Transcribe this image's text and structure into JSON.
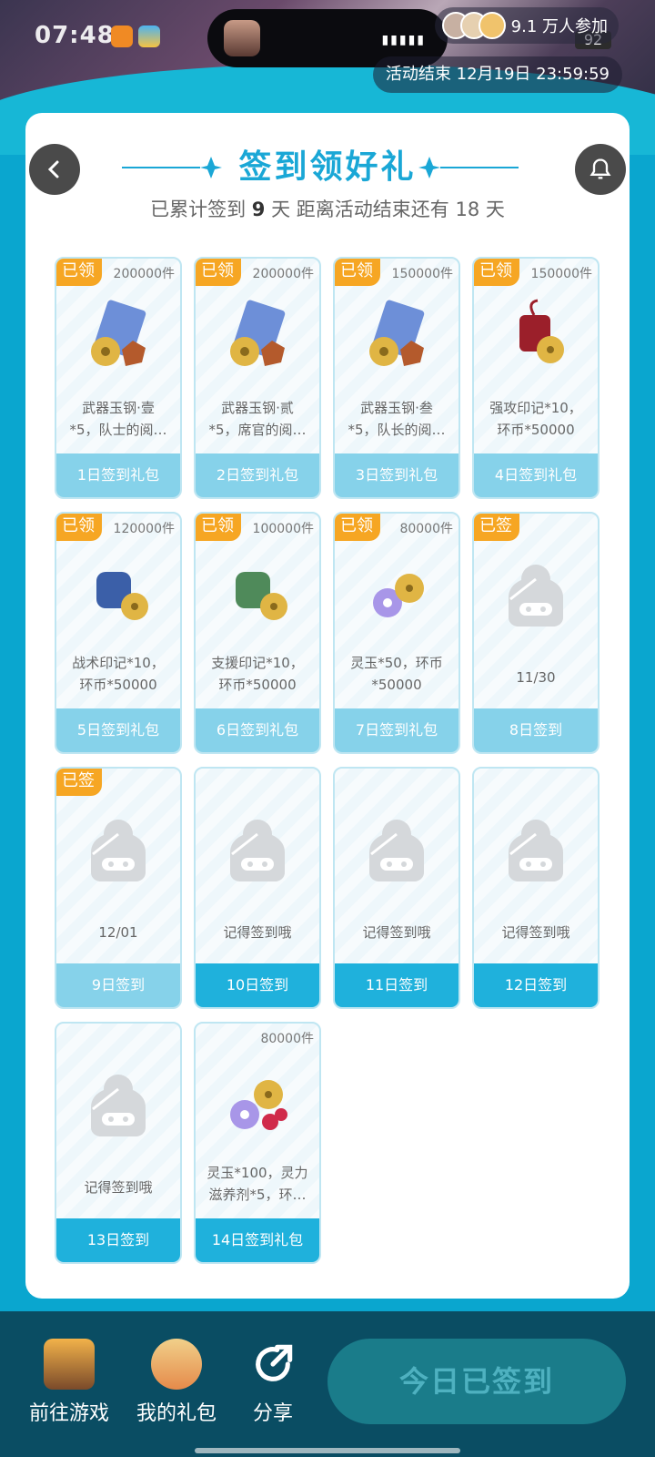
{
  "status_bar": {
    "time": "07:48",
    "battery": "92"
  },
  "header": {
    "participants": "9.1 万人参加",
    "end_time": "活动结束 12月19日 23:59:59"
  },
  "card": {
    "title": "签到领好礼",
    "subtitle_prefix": "已累计签到",
    "signed_days": "9",
    "subtitle_mid": "天  距离活动结束还有",
    "remaining_days": "18",
    "subtitle_suffix": "天"
  },
  "tiles": [
    {
      "badge": "已领",
      "qty": "200000件",
      "desc": "武器玉钢·壹\n*5，队士的阅…",
      "footer": "1日签到礼包",
      "icon": "gift-pack-icon",
      "footer_style": "light"
    },
    {
      "badge": "已领",
      "qty": "200000件",
      "desc": "武器玉钢·贰\n*5，席官的阅…",
      "footer": "2日签到礼包",
      "icon": "gift-pack-icon",
      "footer_style": "light"
    },
    {
      "badge": "已领",
      "qty": "150000件",
      "desc": "武器玉钢·叁\n*5，队长的阅…",
      "footer": "3日签到礼包",
      "icon": "gift-pack-icon",
      "footer_style": "light"
    },
    {
      "badge": "已领",
      "qty": "150000件",
      "desc": "强攻印记*10，\n环币*50000",
      "footer": "4日签到礼包",
      "icon": "charm-red-icon",
      "footer_style": "light"
    },
    {
      "badge": "已领",
      "qty": "120000件",
      "desc": "战术印记*10，\n环币*50000",
      "footer": "5日签到礼包",
      "icon": "charm-blue-icon",
      "footer_style": "light"
    },
    {
      "badge": "已领",
      "qty": "100000件",
      "desc": "支援印记*10，\n环币*50000",
      "footer": "6日签到礼包",
      "icon": "charm-green-icon",
      "footer_style": "light"
    },
    {
      "badge": "已领",
      "qty": "80000件",
      "desc": "灵玉*50，环币\n*50000",
      "footer": "7日签到礼包",
      "icon": "jade-coin-icon",
      "footer_style": "light"
    },
    {
      "badge": "已签",
      "qty": "",
      "desc": "11/30",
      "footer": "8日签到",
      "icon": "placeholder-mascot-icon",
      "footer_style": "light"
    },
    {
      "badge": "已签",
      "qty": "",
      "desc": "12/01",
      "footer": "9日签到",
      "icon": "placeholder-mascot-icon",
      "footer_style": "light"
    },
    {
      "badge": "",
      "qty": "",
      "desc": "记得签到哦",
      "footer": "10日签到",
      "icon": "placeholder-mascot-icon",
      "footer_style": "dark"
    },
    {
      "badge": "",
      "qty": "",
      "desc": "记得签到哦",
      "footer": "11日签到",
      "icon": "placeholder-mascot-icon",
      "footer_style": "dark"
    },
    {
      "badge": "",
      "qty": "",
      "desc": "记得签到哦",
      "footer": "12日签到",
      "icon": "placeholder-mascot-icon",
      "footer_style": "dark"
    },
    {
      "badge": "",
      "qty": "",
      "desc": "记得签到哦",
      "footer": "13日签到",
      "icon": "placeholder-mascot-icon",
      "footer_style": "dark"
    },
    {
      "badge": "",
      "qty": "80000件",
      "desc": "灵玉*100，灵力\n滋养剂*5，环…",
      "footer": "14日签到礼包",
      "icon": "jade-potion-icon",
      "footer_style": "dark"
    }
  ],
  "bottom": {
    "goto_game": "前往游戏",
    "my_gifts": "我的礼包",
    "share": "分享",
    "checked_in": "今日已签到"
  },
  "colors": {
    "accent": "#1fb1dc",
    "badge": "#f6a623",
    "footer_dark": "#0a4d63"
  }
}
